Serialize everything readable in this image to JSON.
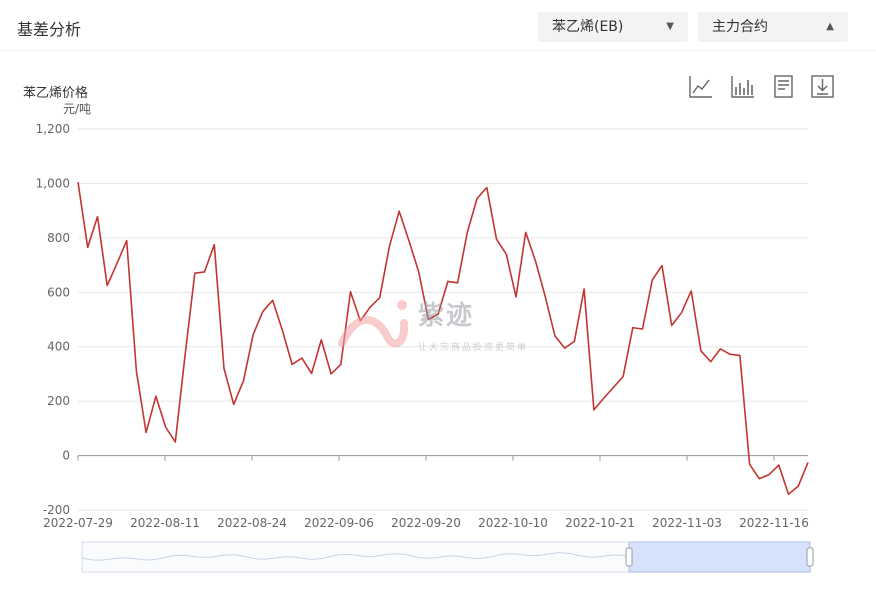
{
  "header": {
    "title": "基差分析",
    "product_select": "苯乙烯(EB)",
    "contract_select": "主力合约"
  },
  "chart_header": {
    "ylabel": "苯乙烯价格",
    "unit": "元/吨"
  },
  "toolbar": {
    "icons": [
      "line-chart-icon",
      "bar-chart-icon",
      "data-view-icon",
      "download-icon"
    ]
  },
  "watermark": {
    "text": "紫迹",
    "subtitle": "让大宗商品投资更简单"
  },
  "colors": {
    "line": "#c23531",
    "grid": "#e6e6e6",
    "axis_text": "#666666",
    "slider_fill": "#d6e2fb",
    "slider_border": "#aebfe6"
  },
  "chart_data": {
    "type": "line",
    "ylabel": "苯乙烯价格",
    "unit": "元/吨",
    "ylim": [
      -200,
      1200
    ],
    "yticks": [
      "1,200",
      "1,000",
      "800",
      "600",
      "400",
      "200",
      "0",
      "-200"
    ],
    "xticks": [
      "2022-07-29",
      "2022-08-11",
      "2022-08-24",
      "2022-09-06",
      "2022-09-20",
      "2022-10-10",
      "2022-10-21",
      "2022-11-03",
      "2022-11-16"
    ],
    "grid": true,
    "series": [
      {
        "values": [
          1005,
          765,
          878,
          625,
          705,
          790,
          310,
          85,
          218,
          105,
          50,
          370,
          670,
          675,
          775,
          320,
          188,
          275,
          445,
          530,
          570,
          460,
          335,
          358,
          302,
          425,
          300,
          335,
          602,
          495,
          545,
          580,
          770,
          898,
          790,
          675,
          500,
          520,
          640,
          635,
          820,
          945,
          985,
          795,
          740,
          583,
          820,
          715,
          585,
          440,
          395,
          420,
          612,
          168,
          210,
          250,
          290,
          470,
          465,
          645,
          698,
          478,
          525,
          605,
          385,
          345,
          392,
          372,
          368,
          -32,
          -85,
          -70,
          -35,
          -142,
          -112,
          -25
        ]
      }
    ]
  }
}
